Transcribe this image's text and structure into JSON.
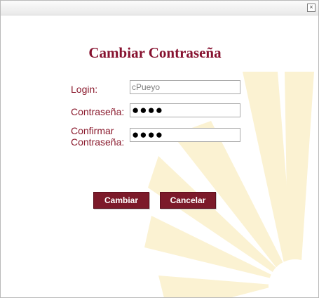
{
  "window": {
    "close_icon": "×"
  },
  "form": {
    "title": "Cambiar Contraseña",
    "login": {
      "label": "Login:",
      "value": "cPueyo"
    },
    "password": {
      "label": "Contraseña:",
      "value": "●●●●"
    },
    "confirm": {
      "label_line1": "Confirmar",
      "label_line2": "Contraseña:",
      "value": "●●●●"
    }
  },
  "buttons": {
    "change_label": "Cambiar",
    "cancel_label": "Cancelar"
  },
  "colors": {
    "accent": "#86112f",
    "button_bg": "#7c1a2a",
    "watermark": "#fbf2d2"
  },
  "icons": {
    "close": "close-icon",
    "watermark": "sun-rays-watermark"
  }
}
